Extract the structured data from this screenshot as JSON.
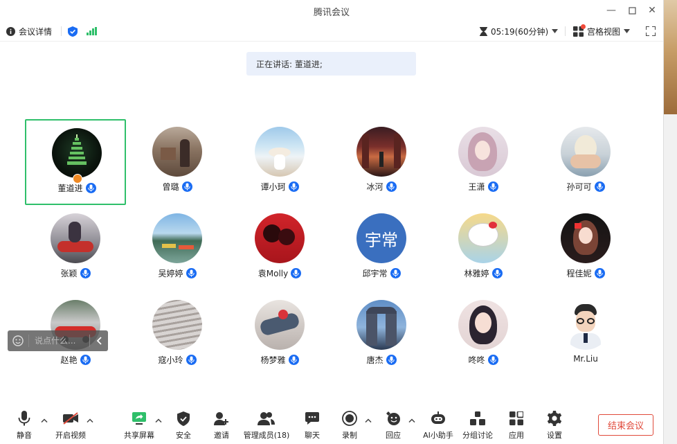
{
  "window": {
    "title": "腾讯会议"
  },
  "top_toolbar": {
    "meeting_info": "会议详情",
    "timer": "05:19(60分钟)",
    "view_mode": "宫格视图"
  },
  "speaker_banner": "正在讲话: 董道进;",
  "participants": [
    {
      "name": "董道进",
      "avatar": "tower-night-avatar",
      "active": true
    },
    {
      "name": "曾璐",
      "avatar": "courtyard-photo-avatar"
    },
    {
      "name": "谭小珂",
      "avatar": "seaside-hat-avatar"
    },
    {
      "name": "冰河",
      "avatar": "street-night-avatar"
    },
    {
      "name": "王潇",
      "avatar": "anime-girl-avatar"
    },
    {
      "name": "孙可可",
      "avatar": "hand-egg-avatar"
    },
    {
      "name": "张颖",
      "avatar": "motorbike-avatar"
    },
    {
      "name": "吴婷婷",
      "avatar": "lake-boat-avatar"
    },
    {
      "name": "袁Molly",
      "avatar": "red-couple-avatar"
    },
    {
      "name": "邱宇常",
      "avatar": "text-avatar",
      "initials": "宇常"
    },
    {
      "name": "林雅婷",
      "avatar": "hello-kitty-avatar"
    },
    {
      "name": "程佳妮",
      "avatar": "cartoon-girl-avatar"
    },
    {
      "name": "赵艳",
      "avatar": "race-car-avatar"
    },
    {
      "name": "寇小玲",
      "avatar": "snow-steps-avatar"
    },
    {
      "name": "杨梦雅",
      "avatar": "flower-branch-avatar"
    },
    {
      "name": "唐杰",
      "avatar": "arch-gate-avatar"
    },
    {
      "name": "咚咚",
      "avatar": "drawn-girl-avatar"
    },
    {
      "name": "Mr.Liu",
      "avatar": "glasses-man-avatar"
    }
  ],
  "chat": {
    "placeholder": "说点什么..."
  },
  "bottom_toolbar": {
    "mute": "静音",
    "video": "开启视频",
    "share": "共享屏幕",
    "security": "安全",
    "invite": "邀请",
    "manage": "管理成员(18)",
    "chat": "聊天",
    "record": "录制",
    "react": "回应",
    "ai": "AI小助手",
    "breakout": "分组讨论",
    "apps": "应用",
    "settings": "设置",
    "end": "结束会议"
  },
  "colors": {
    "accent": "#1a6cf3",
    "active_border": "#2fbf6a",
    "end": "#e0493a",
    "banner": "#eaf0fb"
  }
}
